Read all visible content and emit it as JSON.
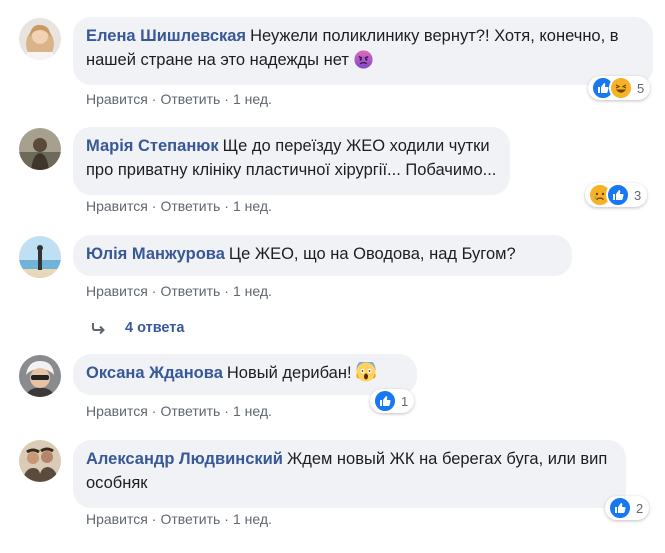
{
  "comments": [
    {
      "author": "Елена Шишлевская",
      "text": "Неужели поликлинику вернут?! Хотя, конечно, в нашей стране на это надежды нет",
      "actions": {
        "like": "Нравится",
        "reply": "Ответить",
        "time": "1 нед."
      },
      "reactions": {
        "count": "5",
        "icons": [
          "like-icon",
          "haha-icon"
        ]
      },
      "emoji": "angry-face-icon"
    },
    {
      "author": "Марія Степанюк",
      "text": "Ще до переїзду ЖЕО ходили чутки про приватну клініку пластичної хірургії... Побачимо...",
      "actions": {
        "like": "Нравится",
        "reply": "Ответить",
        "time": "1 нед."
      },
      "reactions": {
        "count": "3",
        "icons": [
          "sad-icon",
          "like-icon"
        ]
      }
    },
    {
      "author": "Юлія Манжурова",
      "text": "Це ЖЕО, що на Оводова, над Бугом?",
      "actions": {
        "like": "Нравится",
        "reply": "Ответить",
        "time": "1 нед."
      },
      "replies": "4 ответа"
    },
    {
      "author": "Оксана Жданова",
      "text": "Новый дерибан!",
      "actions": {
        "like": "Нравится",
        "reply": "Ответить",
        "time": "1 нед."
      },
      "reactions": {
        "count": "1",
        "icons": [
          "like-icon"
        ]
      },
      "emoji": "screaming-face-icon"
    },
    {
      "author": "Александр Людвинский",
      "text": "Ждем новый ЖК на берегах буга, или вип особняк",
      "actions": {
        "like": "Нравится",
        "reply": "Ответить",
        "time": "1 нед."
      },
      "reactions": {
        "count": "2",
        "icons": [
          "like-icon"
        ]
      }
    }
  ],
  "colors": {
    "author": "#385898",
    "bubble": "#f0f2f5",
    "like": "#1877f2",
    "meta": "#606770"
  }
}
